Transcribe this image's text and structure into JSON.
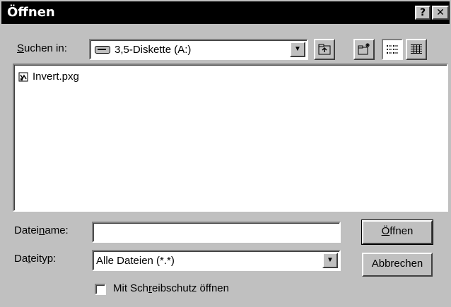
{
  "dialog": {
    "title": "Öffnen",
    "help_label": "?",
    "close_label": "✕"
  },
  "lookin": {
    "label_prefix": "",
    "label_ul": "S",
    "label_rest": "uchen in:",
    "value": "3,5-Diskette (A:)"
  },
  "toolbar": {
    "up_icon": "up-folder-icon",
    "new_folder_icon": "new-folder-icon",
    "list_view_icon": "list-view-icon",
    "details_view_icon": "details-view-icon"
  },
  "files": [
    {
      "name": "Invert.pxg",
      "icon": "document-icon"
    }
  ],
  "filename": {
    "label_prefix": "Datei",
    "label_ul": "n",
    "label_rest": "ame:",
    "value": ""
  },
  "filetype": {
    "label_prefix": "Da",
    "label_ul": "t",
    "label_rest": "eityp:",
    "value": "Alle Dateien (*.*)"
  },
  "buttons": {
    "open_prefix": "",
    "open_ul": "Ö",
    "open_rest": "ffnen",
    "cancel": "Abbrechen"
  },
  "readonly": {
    "label_prefix": "Mit Sch",
    "label_ul": "r",
    "label_rest": "eibschutz öffnen",
    "checked": false
  }
}
